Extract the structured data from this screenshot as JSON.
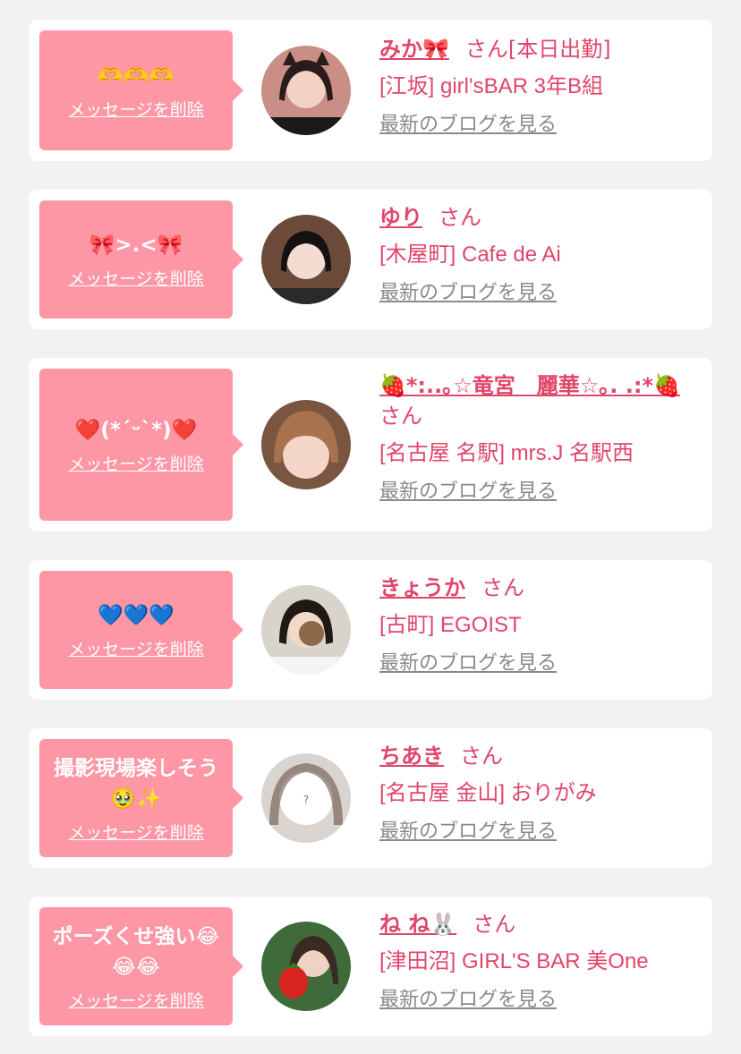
{
  "common": {
    "delete_label": "メッセージを削除",
    "san_label": "さん",
    "blog_label": "最新のブログを見る"
  },
  "colors": {
    "bubble": "#fd97a5",
    "accent": "#e0466a",
    "link_gray": "#8a8a8a",
    "background": "#f2f2f2"
  },
  "cards": [
    {
      "message": "🫶🫶🫶",
      "name": "みか🎀",
      "status": "[本日出勤]",
      "shop": "[江坂] girl'sBAR 3年B組"
    },
    {
      "message": "🎀>.<🎀",
      "name": "ゆり",
      "status": "",
      "shop": "[木屋町] Cafe de Ai"
    },
    {
      "message": "❤️(*´ᵕ`*)❤️",
      "name": "🍓*:..｡☆竜宮　麗華☆｡. .:*🍓",
      "status": "",
      "shop": "[名古屋 名駅] mrs.J 名駅西"
    },
    {
      "message": "💙💙💙",
      "name": "きょうか",
      "status": "",
      "shop": "[古町] EGOIST"
    },
    {
      "message": "撮影現場楽しそう🥹✨",
      "name": "ちあき",
      "status": "",
      "shop": "[名古屋 金山] おりがみ"
    },
    {
      "message": "ポーズくせ強い😂😂😂",
      "name": "ね ね🐰",
      "status": "",
      "shop": "[津田沼] GIRL'S BAR 美One"
    }
  ]
}
